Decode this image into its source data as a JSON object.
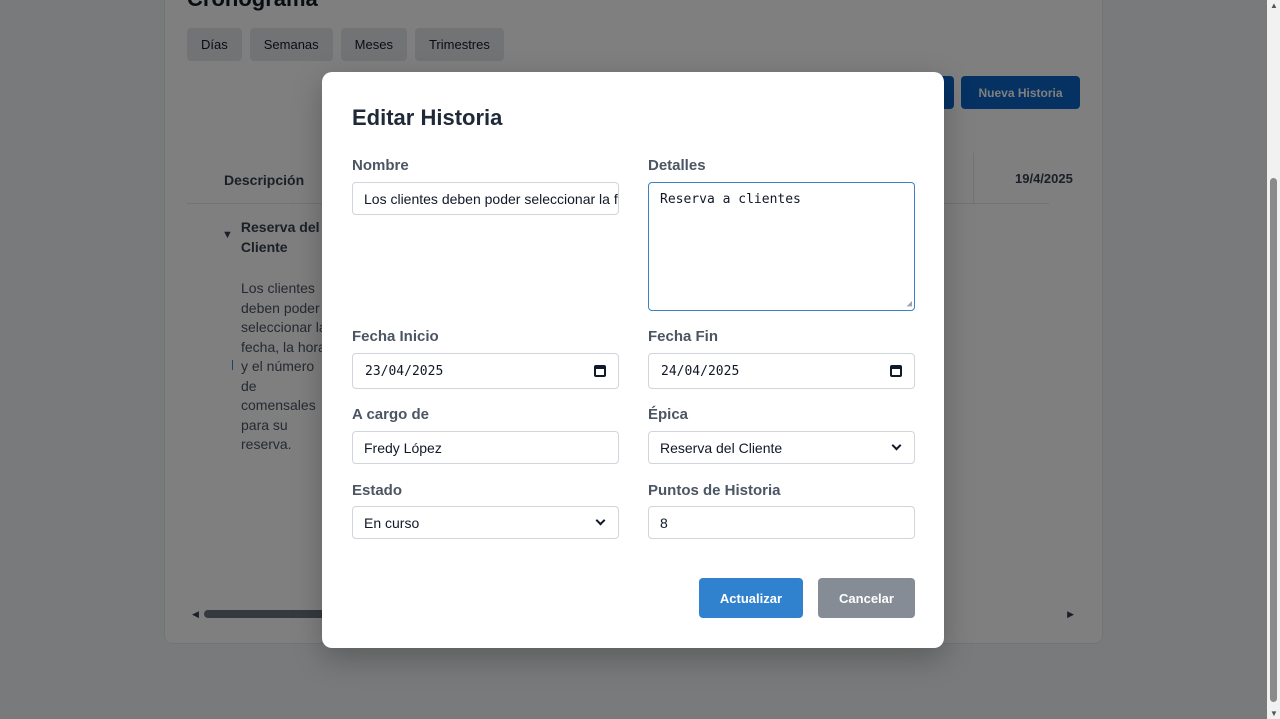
{
  "page": {
    "title": "Cronograma",
    "view_tabs": [
      "Días",
      "Semanas",
      "Meses",
      "Trimestres"
    ],
    "new_story_button": "Nueva Historia",
    "gantt": {
      "description_header": "Descripción",
      "date_header": "19/4/2025",
      "epic_name": "Reserva del Cliente",
      "story_description": "Los clientes deben poder seleccionar la fecha, la hora y el número de comensales para su reserva."
    }
  },
  "modal": {
    "title": "Editar Historia",
    "fields": {
      "nombre": {
        "label": "Nombre",
        "value": "Los clientes deben poder seleccionar la fecha, la hora y el número de comensales para su reserva."
      },
      "detalles": {
        "label": "Detalles",
        "value": "Reserva a clientes"
      },
      "fecha_inicio": {
        "label": "Fecha Inicio",
        "value": "23/04/2025"
      },
      "fecha_fin": {
        "label": "Fecha Fin",
        "value": "24/04/2025"
      },
      "a_cargo": {
        "label": "A cargo de",
        "value": "Fredy López"
      },
      "epica": {
        "label": "Épica",
        "value": "Reserva del Cliente"
      },
      "estado": {
        "label": "Estado",
        "value": "En curso"
      },
      "puntos": {
        "label": "Puntos de Historia",
        "value": "8"
      }
    },
    "buttons": {
      "update": "Actualizar",
      "cancel": "Cancelar"
    }
  },
  "colors": {
    "primary": "#3182ce",
    "secondary": "#858c96",
    "brand": "#0b63c7"
  },
  "icons": [
    "calendar-icon",
    "chevron-down-icon",
    "caret-down-icon",
    "resize-grip-icon"
  ]
}
